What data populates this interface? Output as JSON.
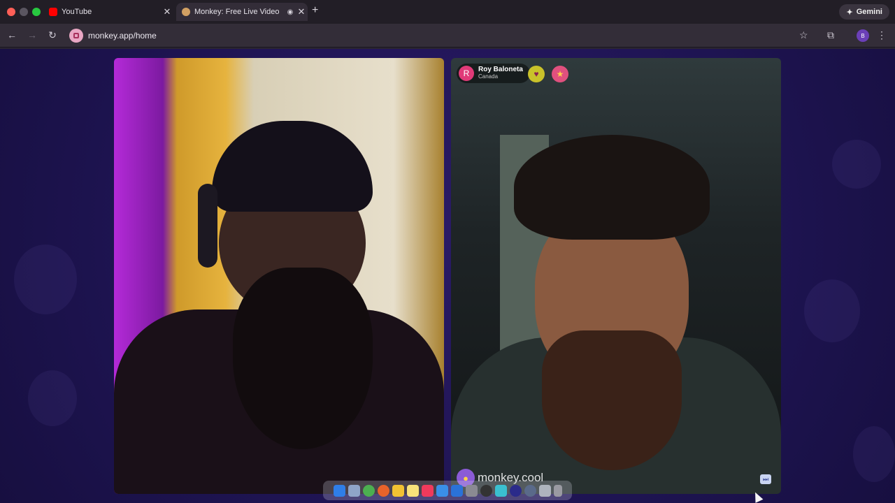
{
  "browser": {
    "tabs": [
      {
        "title": "YouTube",
        "favicon": "youtube-icon",
        "color": "#ff0000"
      },
      {
        "title": "Monkey: Free Live Video",
        "favicon": "monkey-icon",
        "color": "#d2a063",
        "active": true
      }
    ],
    "url": "monkey.app/home",
    "gemini_label": "Gemini",
    "profile_initial": "B"
  },
  "call": {
    "remote_user": {
      "initial": "R",
      "name": "Roy Baloneta",
      "country": "Canada"
    },
    "watermark": "monkey.cool",
    "colors": {
      "page_bg": "#1e1452",
      "accent_pink": "#e03a78",
      "badge_yellow": "#c9c22a",
      "badge_pink": "#e0507e"
    }
  },
  "dock": {
    "apps": [
      "finder-icon",
      "launchpad-icon",
      "chrome-icon",
      "firefox-icon",
      "photos-icon",
      "notes-icon",
      "music-icon",
      "mail-icon",
      "messages-icon",
      "settings-icon",
      "activity-icon",
      "live-icon",
      "screen-icon",
      "zoom-icon",
      "terminal-icon",
      "trash-icon"
    ]
  }
}
